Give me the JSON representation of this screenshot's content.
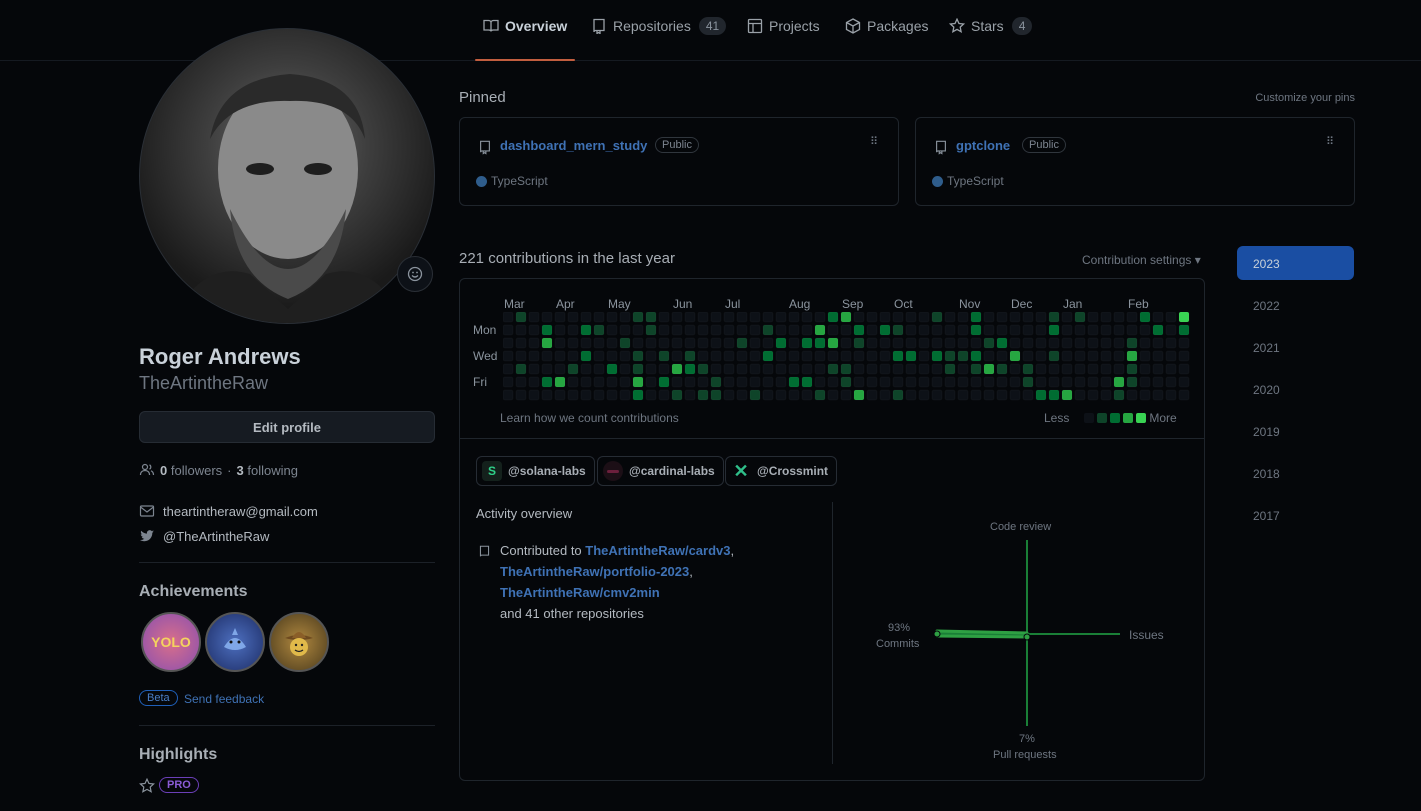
{
  "tabs": [
    {
      "label": "Overview",
      "count": null,
      "icon": "book-icon",
      "active": true
    },
    {
      "label": "Repositories",
      "count": "41",
      "icon": "repo-icon"
    },
    {
      "label": "Projects",
      "count": null,
      "icon": "table-icon"
    },
    {
      "label": "Packages",
      "count": null,
      "icon": "package-icon"
    },
    {
      "label": "Stars",
      "count": "4",
      "icon": "star-icon"
    }
  ],
  "profile": {
    "name": "Roger Andrews",
    "login": "TheArtintheRaw",
    "edit_label": "Edit profile",
    "followers": "0",
    "followers_label": "followers",
    "dot": "·",
    "following": "3",
    "following_label": "following",
    "email": "theartintheraw@gmail.com",
    "twitter": "@TheArtintheRaw"
  },
  "achievements": {
    "title": "Achievements",
    "badges": [
      "yolo-badge",
      "pull-shark-badge",
      "quickdraw-badge"
    ],
    "beta": "Beta",
    "feedback": "Send feedback"
  },
  "highlights": {
    "title": "Highlights",
    "pro": "PRO"
  },
  "pinned": {
    "title": "Pinned",
    "customize": "Customize your pins",
    "repos": [
      {
        "name": "dashboard_mern_study",
        "visibility": "Public",
        "language": "TypeScript",
        "lang_color": "#2f5d8c"
      },
      {
        "name": "gptclone",
        "visibility": "Public",
        "language": "TypeScript",
        "lang_color": "#2f5d8c"
      }
    ]
  },
  "contributions": {
    "title": "221 contributions in the last year",
    "settings": "Contribution settings ▾",
    "months": [
      "Mar",
      "Apr",
      "May",
      "Jun",
      "Jul",
      "Aug",
      "Sep",
      "Oct",
      "Nov",
      "Dec",
      "Jan",
      "Feb"
    ],
    "days": [
      "Mon",
      "Wed",
      "Fri"
    ],
    "learn": "Learn how we count contributions",
    "less": "Less",
    "more": "More",
    "levels": [
      "#0d1117",
      "#0e4429",
      "#006d32",
      "#26a641",
      "#39d353"
    ]
  },
  "orgs": [
    {
      "handle": "@solana-labs",
      "icon": "S"
    },
    {
      "handle": "@cardinal-labs",
      "icon": ""
    },
    {
      "handle": "@Crossmint",
      "icon": "✕"
    }
  ],
  "activity": {
    "title": "Activity overview",
    "contributed_to": "Contributed to",
    "repo1": "TheArtintheRaw/cardv3",
    "comma": ",",
    "repo2": "TheArtintheRaw/portfolio-2023",
    "repo3": "TheArtintheRaw/cmv2min",
    "other": "and 41 other repositories"
  },
  "overview_chart": {
    "code_review": "Code review",
    "issues": "Issues",
    "commits_pct": "93%",
    "commits": "Commits",
    "pr_pct": "7%",
    "pull_requests": "Pull requests"
  },
  "years": [
    "2023",
    "2022",
    "2021",
    "2020",
    "2019",
    "2018",
    "2017"
  ]
}
